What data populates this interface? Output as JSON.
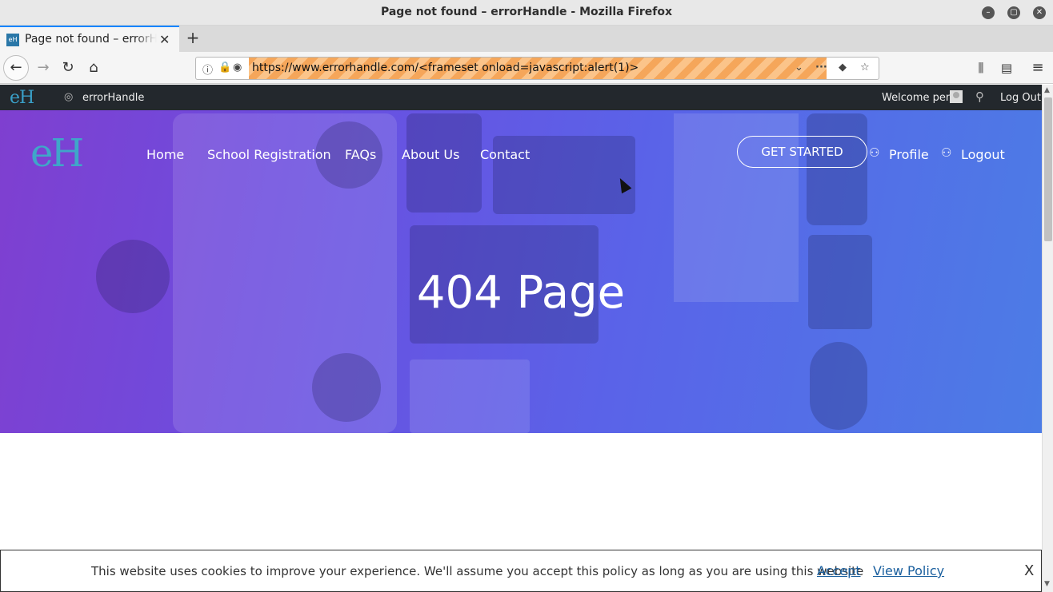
{
  "window": {
    "title": "Page not found – errorHandle - Mozilla Firefox",
    "controls": [
      "minimize-icon",
      "maximize-icon",
      "close-icon"
    ]
  },
  "tabs": [
    {
      "label": "Page not found – errorHandle",
      "favicon": "eH"
    }
  ],
  "toolbar": {
    "url": "https://www.errorhandle.com/<frameset onload=javascript:alert(1)>",
    "icons": [
      "back-icon",
      "forward-icon",
      "reload-icon",
      "home-icon",
      "info-icon",
      "lock-icon",
      "tracking-icon",
      "dropdown-icon",
      "more-icon",
      "pocket-icon",
      "bookmark-star-icon",
      "library-icon",
      "sidebar-icon",
      "menu-icon"
    ]
  },
  "site_topbar": {
    "site_name": "errorHandle",
    "welcome": "Welcome pen",
    "logout": "Log Out"
  },
  "hero": {
    "logo": "eH",
    "nav": [
      "Home",
      "School Registration",
      "FAQs",
      "About Us",
      "Contact"
    ],
    "cta": "GET STARTED",
    "profile": "Profile",
    "logout": "Logout",
    "headline": "404 Page"
  },
  "cookie": {
    "message": "This website uses cookies to improve your experience. We'll assume you accept this policy as long as you are using this website",
    "accept": "Accept",
    "policy": "View Policy",
    "close": "X"
  },
  "colors": {
    "hero_gradient_start": "#7f3fd0",
    "hero_gradient_end": "#4c7ce6",
    "topbar_bg": "#23282d",
    "url_highlight": "#f5a65a",
    "link": "#1a5f9e"
  }
}
